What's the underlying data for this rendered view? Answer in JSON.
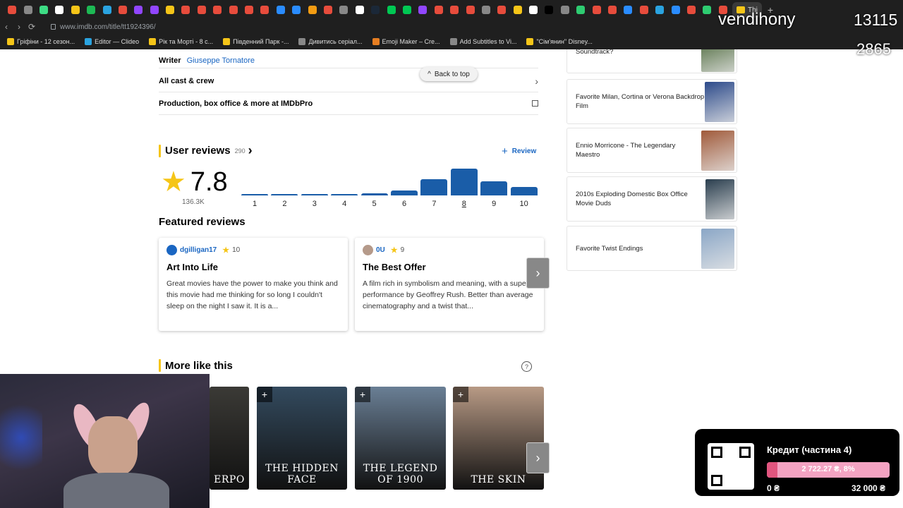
{
  "browser": {
    "tab_colors": [
      "#e74c3c",
      "#888888",
      "#3ddc84",
      "#ffffff",
      "#f5c518",
      "#1db954",
      "#2aa3e0",
      "#e74c3c",
      "#9146ff",
      "#9146ff",
      "#f5c518",
      "#e74c3c",
      "#e74c3c",
      "#e74c3c",
      "#e74c3c",
      "#e74c3c",
      "#e74c3c",
      "#2a8cff",
      "#2a8cff",
      "#f39c12",
      "#e74c3c",
      "#888888",
      "#ffffff",
      "#1b2838",
      "#00c853",
      "#00c853",
      "#9146ff",
      "#e74c3c",
      "#e74c3c",
      "#e74c3c",
      "#888888",
      "#e74c3c",
      "#f5c518",
      "#ffffff",
      "#000000",
      "#888888",
      "#2ecc71",
      "#e74c3c",
      "#e74c3c",
      "#2a8cff",
      "#e74c3c",
      "#2aa3e0",
      "#2a8cff",
      "#e74c3c",
      "#2ecc71",
      "#e74c3c"
    ],
    "active_tab_label": "Thi",
    "new_tab_icon": "+",
    "url": "www.imdb.com/title/tt1924396/",
    "bookmarks": [
      {
        "label": "Грiфiни - 12 сезон...",
        "color": "#f5c518"
      },
      {
        "label": "Editor — Clideo",
        "color": "#2aa3e0"
      },
      {
        "label": "Рiк та Морті - 8 с...",
        "color": "#f5c518"
      },
      {
        "label": "Південний Парк -...",
        "color": "#f5c518"
      },
      {
        "label": "Дивитись серiал...",
        "color": "#888888"
      },
      {
        "label": "Emoji Maker – Cre...",
        "color": "#e67e22"
      },
      {
        "label": "Add Subtitles to Vi...",
        "color": "#888888"
      },
      {
        "label": "\"Сiм'янин\" Disney...",
        "color": "#f5c518"
      }
    ]
  },
  "credits": {
    "writer_label": "Writer",
    "writer_name": "Giuseppe Tornatore",
    "all_cast": "All cast & crew",
    "imdbpro": "Production, box office & more at IMDbPro",
    "back_to_top": "Back to top"
  },
  "user_reviews": {
    "title": "User reviews",
    "count": "290",
    "review_button": "Review",
    "rating": "7.8",
    "votes": "136.3K",
    "selected_bar": "8"
  },
  "chart_data": {
    "type": "bar",
    "categories": [
      "1",
      "2",
      "3",
      "4",
      "5",
      "6",
      "7",
      "8",
      "9",
      "10"
    ],
    "values": [
      1,
      1,
      1,
      2,
      4,
      10,
      32,
      52,
      28,
      17
    ],
    "ylim": [
      0,
      52
    ]
  },
  "featured": {
    "title": "Featured reviews",
    "cards": [
      {
        "user": "dgilligan17",
        "rating": "10",
        "headline": "Art Into Life",
        "body": "Great movies have the power to make you think and this movie had me thinking for so long I couldn't sleep on the night I saw it. It is a...",
        "avatar_color": "#1a66c2"
      },
      {
        "user": "0U",
        "rating": "9",
        "headline": "The Best Offer",
        "body": "A film rich in symbolism and meaning, with a superb performance by Geoffrey Rush. Better than average cinematography and a twist that...",
        "avatar_color": "#b59a8a"
      }
    ]
  },
  "more_like": {
    "title": "More like this",
    "posters": [
      {
        "title": "ERPO",
        "bg": "#3b3a36"
      },
      {
        "title": "THE HIDDEN FACE",
        "bg": "#334a5e"
      },
      {
        "title": "THE LEGEND OF 1900",
        "bg": "#6a7f95"
      },
      {
        "title": "THE SKIN",
        "bg": "#b89a85"
      }
    ]
  },
  "lists": [
    {
      "title": "Soundtrack?",
      "color": "#3d5c2a"
    },
    {
      "title": "Favorite Milan, Cortina or Verona Backdrop Film",
      "color": "#2c4a8a"
    },
    {
      "title": "Ennio Morricone - The Legendary Maestro",
      "color": "#a05a3a"
    },
    {
      "title": "2010s Exploding Domestic Box Office Movie Duds",
      "color": "#2a3e4e"
    },
    {
      "title": "Favorite Twist Endings",
      "color": "#8aa6c6"
    }
  ],
  "stream": {
    "username": "vendihony",
    "stat_1": "13115",
    "stat_2": "2865",
    "donation_title": "Кредит (частина 4)",
    "donation_progress_text": "2 722.27 ₴, 8%",
    "donation_fraction": 0.085,
    "donation_min": "0 ₴",
    "donation_max": "32 000 ₴"
  }
}
